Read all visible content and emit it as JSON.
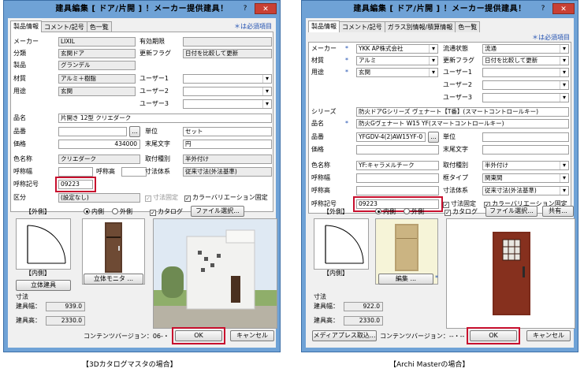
{
  "d1": {
    "title": "建具編集 [ ドア/片開 ] ！メーカー提供建具！",
    "title_help": "?",
    "title_close": "✕",
    "tabs": [
      "製品情報",
      "コメント/記号",
      "色一覧"
    ],
    "required_note": "＊は必須項目",
    "labels": {
      "maker": "メーカー",
      "bunrui": "分類",
      "seihin": "製品",
      "zaishitsu": "材質",
      "youto": "用途",
      "hinmei": "品名",
      "hinban": "品番",
      "kakaku": "価格",
      "iromeisho": "色名称",
      "yobihaba": "呼称幅",
      "yobitaka": "呼称高",
      "yobikigo": "呼称記号",
      "kubun": "区分",
      "yuko": "有効期限",
      "koushin": "更新フラグ",
      "user1": "ユーザー1",
      "user2": "ユーザー2",
      "user3": "ユーザー3",
      "tani": "単位",
      "matsubi": "末尾文字",
      "toritsuke": "取付種別",
      "sunpo": "寸法体系"
    },
    "values": {
      "maker": "LIXIL",
      "bunrui": "玄関ドア",
      "seihin": "グランデル",
      "zaishitsu": "アルミ＋樹脂",
      "youto": "玄関",
      "hinmei": "片開き 12型 クリエダーク",
      "hinban": "",
      "kakaku": "434000",
      "iromeisho": "クリエダーク",
      "yobihaba": "",
      "yobitaka": "",
      "yobikigo": "09223",
      "kubun": "(設定なし)",
      "yuko": "",
      "koushin": "日付を比較して更新",
      "tani": "セット",
      "matsubi": "円",
      "toritsuke": "半外付け",
      "sunpo": "従来寸法(外法基準)"
    },
    "hinban_btn": "...",
    "chk_sunpo": "寸法固定",
    "chk_color": "カラーバリエーション固定",
    "gaiho": "【外側】",
    "naiho": "【内側】",
    "radio_in": "内側",
    "radio_out": "外側",
    "chk_catalog": "カタログ",
    "file_btn": "ファイル選択...",
    "rittai_btn": "立体建具",
    "monitor_btn": "立体モニタ ...",
    "sunpo_title": "寸法",
    "width_label": "建具幅：",
    "width_val": "939.0",
    "height_label": "建具高：",
    "height_val": "2330.0",
    "contents_ver": "コンテンツバージョン：06-・・・",
    "ok": "OK",
    "cancel": "キャンセル"
  },
  "d2": {
    "title": "建具編集 [ ドア/片開 ] ！メーカー提供建具！",
    "title_help": "?",
    "title_close": "✕",
    "tabs": [
      "製品情報",
      "コメント/記号",
      "ガラス別情報/積算情報",
      "色一覧"
    ],
    "required_note": "＊は必須項目",
    "labels": {
      "maker": "メーカー",
      "zaishitsu": "材質",
      "youto": "用途",
      "series": "シリーズ",
      "hinmei": "品名",
      "hinban": "品番",
      "kakaku": "価格",
      "iromeisho": "色名称",
      "yobihaba": "呼称幅",
      "yobitaka": "呼称高",
      "yobikigo": "呼称記号",
      "ryutsu": "流通状態",
      "koushin": "更新フラグ",
      "user1": "ユーザー1",
      "user2": "ユーザー2",
      "user3": "ユーザー3",
      "tani": "単位",
      "matsubi": "末尾文字",
      "toritsuke": "取付種別",
      "kamachi": "框タイプ",
      "sunpo": "寸法体系"
    },
    "values": {
      "maker": "YKK AP株式会社",
      "zaishitsu": "アルミ",
      "youto": "玄関",
      "series": "防火ドアGシリーズ ヴェナート【T番】(スマートコントロールキー)",
      "hinmei": "防火Gヴェナート W15 YF(スマートコントロールキー)",
      "hinban": "YFGDV-4(2)AW15YF-0",
      "kakaku": "",
      "iromeisho": "YF:キャラメルチーク",
      "yobihaba": "",
      "yobitaka": "",
      "yobikigo": "09223",
      "ryutsu": "流通",
      "koushin": "日付を比較して更新",
      "tani": "",
      "matsubi": "",
      "toritsuke": "半外付け",
      "kamachi": "関東間",
      "sunpo": "従来寸法(外法基準)"
    },
    "hinban_btn": "...",
    "chk_sunpo": "寸法固定",
    "chk_color": "カラーバリエーション固定",
    "gaiho": "【外側】",
    "naiho": "【内側】",
    "radio_in": "内側",
    "radio_out": "外側",
    "chk_catalog": "カタログ",
    "file_btn": "ファイル選択...",
    "share_btn": "共有...",
    "edit_btn": "編集 ...",
    "sunpo_title": "寸法",
    "width_label": "建具幅：",
    "width_val": "922.0",
    "height_label": "建具高：",
    "height_val": "2330.0",
    "media_btn": "メディアプレス取込...",
    "contents_ver": "コンテンツバージョン：--・--",
    "ok": "OK",
    "cancel": "キャンセル"
  },
  "captions": {
    "left": "【3Dカタログマスタの場合】",
    "right": "【Archi Masterの場合】"
  },
  "colors": {
    "title_bar": "#6fa2d6",
    "highlight": "#c8102e",
    "required": "#1f4fb0",
    "door_red": "#7a2a1a"
  }
}
